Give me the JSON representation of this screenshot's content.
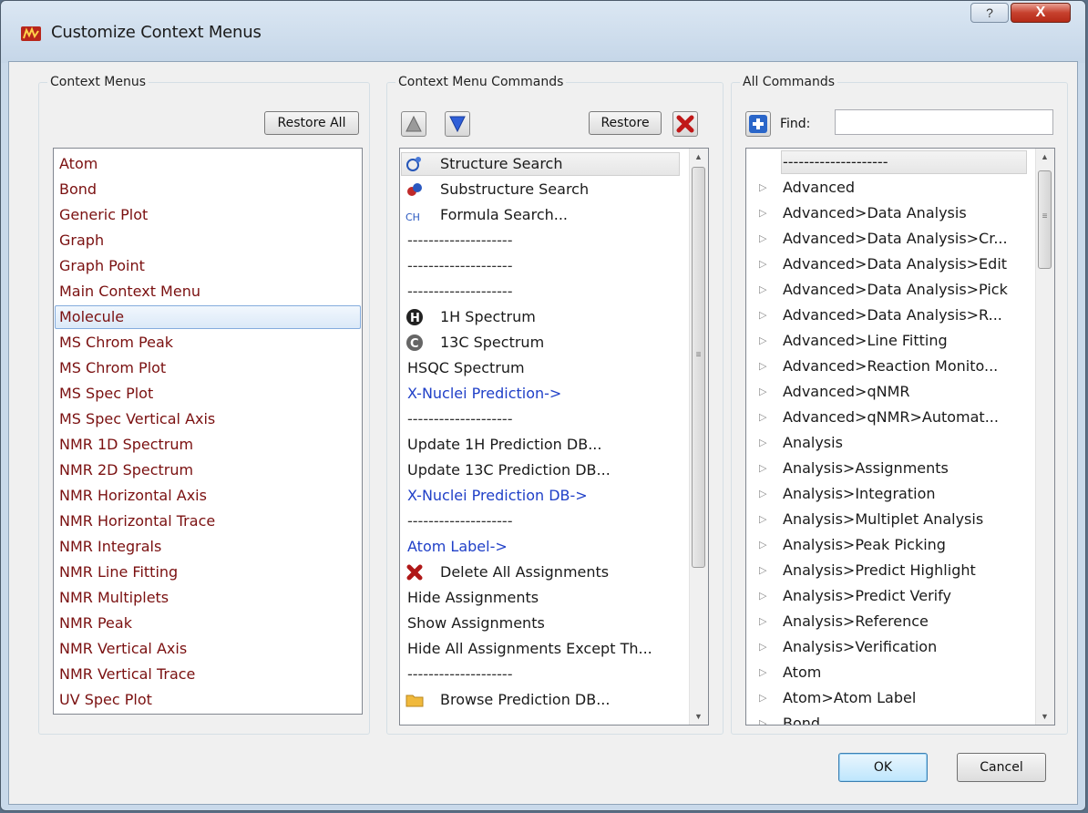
{
  "window": {
    "title": "Customize Context Menus"
  },
  "titlebar": {
    "help_label": "?",
    "close_label": "X"
  },
  "context_menus": {
    "group_label": "Context Menus",
    "restore_all_label": "Restore All",
    "items": [
      "Atom",
      "Bond",
      "Generic Plot",
      "Graph",
      "Graph Point",
      "Main Context Menu",
      "Molecule",
      "MS Chrom Peak",
      "MS Chrom Plot",
      "MS Spec Plot",
      "MS Spec Vertical Axis",
      "NMR 1D Spectrum",
      "NMR 2D Spectrum",
      "NMR Horizontal Axis",
      "NMR Horizontal Trace",
      "NMR Integrals",
      "NMR Line Fitting",
      "NMR Multiplets",
      "NMR Peak",
      "NMR Vertical Axis",
      "NMR Vertical Trace",
      "UV Spec Plot"
    ],
    "selected": "Molecule"
  },
  "context_menu_commands": {
    "group_label": "Context Menu Commands",
    "restore_label": "Restore",
    "move_up_icon": "triangle-up-icon",
    "move_down_icon": "triangle-down-icon",
    "delete_icon": "red-x-icon",
    "items": [
      {
        "text": "Structure Search",
        "icon": "structure-search-icon",
        "style": "dark"
      },
      {
        "text": "Substructure Search",
        "icon": "substructure-search-icon",
        "style": "dark"
      },
      {
        "text": "Formula Search...",
        "icon": "formula-search-icon",
        "style": "dark"
      },
      {
        "text": "--------------------",
        "icon": "",
        "style": "sep"
      },
      {
        "text": "--------------------",
        "icon": "",
        "style": "sep"
      },
      {
        "text": "--------------------",
        "icon": "",
        "style": "sep"
      },
      {
        "text": "1H Spectrum",
        "icon": "1h-spectrum-icon",
        "style": "dark"
      },
      {
        "text": "13C Spectrum",
        "icon": "13c-spectrum-icon",
        "style": "dark"
      },
      {
        "text": "HSQC Spectrum",
        "icon": "",
        "style": "dark"
      },
      {
        "text": "X-Nuclei Prediction->",
        "icon": "",
        "style": "blue"
      },
      {
        "text": "--------------------",
        "icon": "",
        "style": "sep"
      },
      {
        "text": "Update 1H Prediction DB...",
        "icon": "",
        "style": "dark"
      },
      {
        "text": "Update 13C Prediction DB...",
        "icon": "",
        "style": "dark"
      },
      {
        "text": "X-Nuclei Prediction DB->",
        "icon": "",
        "style": "blue"
      },
      {
        "text": "--------------------",
        "icon": "",
        "style": "sep"
      },
      {
        "text": "Atom Label->",
        "icon": "",
        "style": "blue"
      },
      {
        "text": "Delete All Assignments",
        "icon": "delete-assignments-icon",
        "style": "dark"
      },
      {
        "text": "Hide Assignments",
        "icon": "",
        "style": "dark"
      },
      {
        "text": "Show Assignments",
        "icon": "",
        "style": "dark"
      },
      {
        "text": "Hide All Assignments Except Th...",
        "icon": "",
        "style": "dark"
      },
      {
        "text": "--------------------",
        "icon": "",
        "style": "sep"
      },
      {
        "text": "Browse Prediction DB...",
        "icon": "folder-icon",
        "style": "dark"
      }
    ]
  },
  "all_commands": {
    "group_label": "All Commands",
    "add_icon": "plus-icon",
    "find_label": "Find:",
    "find_value": "",
    "items": [
      "--------------------",
      "Advanced",
      "Advanced>Data Analysis",
      "Advanced>Data Analysis>Cr...",
      "Advanced>Data Analysis>Edit",
      "Advanced>Data Analysis>Pick",
      "Advanced>Data Analysis>R...",
      "Advanced>Line Fitting",
      "Advanced>Reaction Monito...",
      "Advanced>qNMR",
      "Advanced>qNMR>Automat...",
      "Analysis",
      "Analysis>Assignments",
      "Analysis>Integration",
      "Analysis>Multiplet Analysis",
      "Analysis>Peak Picking",
      "Analysis>Predict  Highlight",
      "Analysis>Predict  Verify",
      "Analysis>Reference",
      "Analysis>Verification",
      "Atom",
      "Atom>Atom Label",
      "Bond"
    ]
  },
  "footer": {
    "ok_label": "OK",
    "cancel_label": "Cancel"
  },
  "colors": {
    "maroon": "#7a1010",
    "blue": "#2040c8",
    "selection": "#dbe9f8"
  }
}
